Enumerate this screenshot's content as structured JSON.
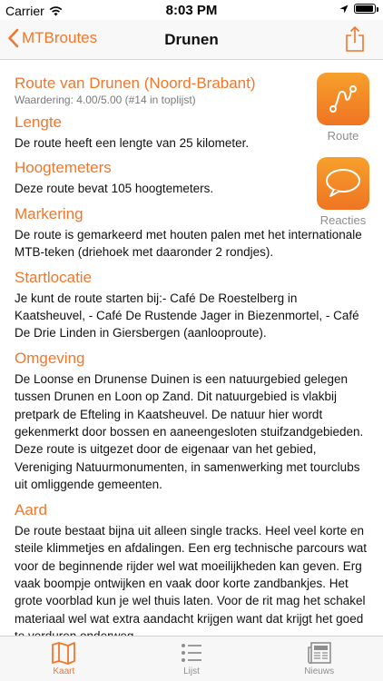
{
  "status": {
    "carrier": "Carrier",
    "time": "8:03 PM",
    "battery_level": 0.95
  },
  "nav": {
    "back_label": "MTBroutes",
    "title": "Drunen"
  },
  "route": {
    "title": "Route van Drunen (Noord-Brabant)",
    "rating": "Waardering: 4.00/5.00 (#14 in toplijst)"
  },
  "side_buttons": {
    "route_label": "Route",
    "reactions_label": "Reacties"
  },
  "sections": [
    {
      "heading": "Lengte",
      "body": "De route heeft een lengte van 25 kilometer."
    },
    {
      "heading": "Hoogtemeters",
      "body": "Deze route bevat 105 hoogtemeters."
    },
    {
      "heading": "Markering",
      "body": "De route is gemarkeerd met houten palen met het internationale MTB-teken (driehoek met daaronder 2 rondjes)."
    },
    {
      "heading": "Startlocatie",
      "body": "Je kunt de route starten bij:- Café De Roestelberg in Kaatsheuvel, - Café De Rustende Jager in Biezenmortel, - Café De Drie Linden in Giersbergen (aanlooproute)."
    },
    {
      "heading": "Omgeving",
      "body": "De Loonse en Drunense Duinen is een natuurgebied gelegen tussen Drunen en Loon op Zand. Dit natuurgebied is vlakbij pretpark de Efteling in Kaatsheuvel. De natuur hier wordt gekenmerkt door bossen en aaneengesloten stuifzandgebieden. Deze route is uitgezet door de eigenaar van het gebied, Vereniging Natuurmonumenten, in samenwerking met tourclubs uit omliggende gemeenten."
    },
    {
      "heading": "Aard",
      "body": "De route bestaat bijna uit alleen single tracks. Heel veel korte en steile klimmetjes en afdalingen. Een erg technische parcours wat voor de beginnende rijder wel wat moeilijkheden kan geven. Erg vaak boompje ontwijken en vaak door korte zandbankjes. Het grote voorblad kun je wel thuis laten. Voor de rit mag het schakel materiaal wel wat extra aandacht krijgen want dat krijgt het goed te verduren onderweg."
    }
  ],
  "tabs": [
    {
      "label": "Kaart",
      "icon": "map-icon",
      "active": true
    },
    {
      "label": "Lijst",
      "icon": "list-icon",
      "active": false
    },
    {
      "label": "Nieuws",
      "icon": "newspaper-icon",
      "active": false
    }
  ],
  "colors": {
    "accent": "#f0772b",
    "inactive": "#8e8e8e"
  }
}
